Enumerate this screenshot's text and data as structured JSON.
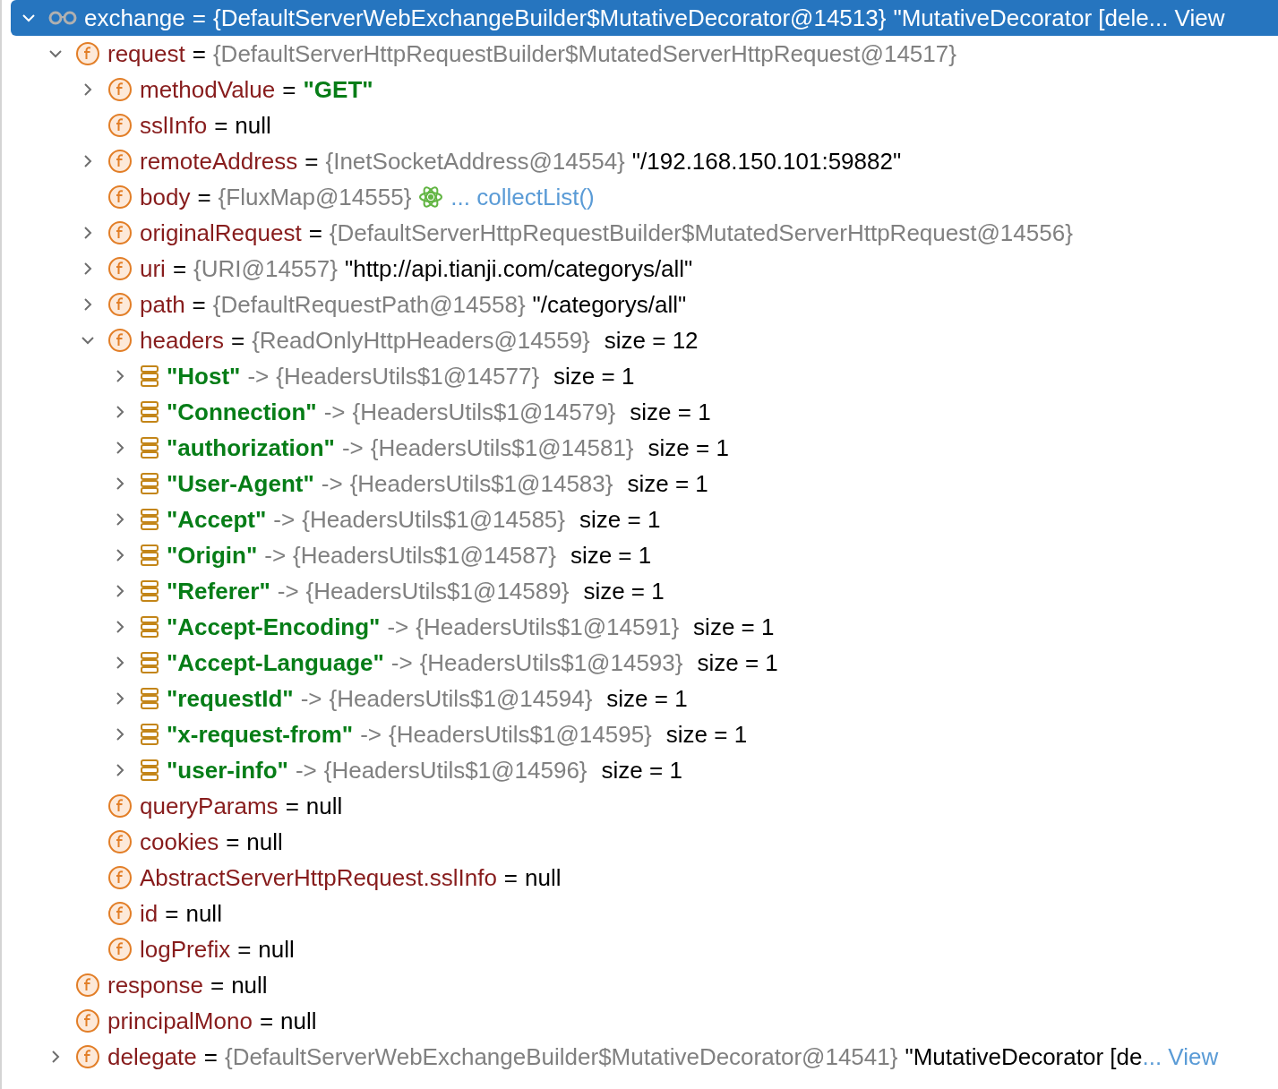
{
  "tree": [
    {
      "kind": "watch",
      "name": "exchange",
      "separator": "=",
      "type": "{DefaultServerWebExchangeBuilder$MutativeDecorator@14513}",
      "value": "\"MutativeDecorator [dele",
      "string": false,
      "link": "... View",
      "expanded": true,
      "selected": true,
      "children": [
        {
          "kind": "field",
          "name": "request",
          "separator": "=",
          "type": "{DefaultServerHttpRequestBuilder$MutatedServerHttpRequest@14517}",
          "expanded": true,
          "selected": false,
          "children": [
            {
              "kind": "field",
              "name": "methodValue",
              "separator": "=",
              "value": "\"GET\"",
              "string": true,
              "expanded": false,
              "selected": false
            },
            {
              "kind": "field",
              "name": "sslInfo",
              "separator": "=",
              "value": "null",
              "string": false,
              "selected": false
            },
            {
              "kind": "field",
              "name": "remoteAddress",
              "separator": "=",
              "type": "{InetSocketAddress@14554}",
              "value": "\"/192.168.150.101:59882\"",
              "string": false,
              "expanded": false,
              "selected": false
            },
            {
              "kind": "field",
              "name": "body",
              "separator": "=",
              "type": "{FluxMap@14555}",
              "action": true,
              "link": "... collectList()",
              "selected": false
            },
            {
              "kind": "field",
              "name": "originalRequest",
              "separator": "=",
              "type": "{DefaultServerHttpRequestBuilder$MutatedServerHttpRequest@14556}",
              "expanded": false,
              "selected": false
            },
            {
              "kind": "field",
              "name": "uri",
              "separator": "=",
              "type": "{URI@14557}",
              "value": "\"http://api.tianji.com/categorys/all\"",
              "string": false,
              "expanded": false,
              "selected": false
            },
            {
              "kind": "field",
              "name": "path",
              "separator": "=",
              "type": "{DefaultRequestPath@14558}",
              "value": "\"/categorys/all\"",
              "string": false,
              "expanded": false,
              "selected": false
            },
            {
              "kind": "field",
              "name": "headers",
              "separator": "=",
              "type": "{ReadOnlyHttpHeaders@14559}",
              "size": "size = 12",
              "expanded": true,
              "selected": false,
              "children": [
                {
                  "kind": "entry",
                  "name": "\"Host\"",
                  "separator": "->",
                  "type": "{HeadersUtils$1@14577}",
                  "size": "size = 1",
                  "expanded": false,
                  "selected": false
                },
                {
                  "kind": "entry",
                  "name": "\"Connection\"",
                  "separator": "->",
                  "type": "{HeadersUtils$1@14579}",
                  "size": "size = 1",
                  "expanded": false,
                  "selected": false
                },
                {
                  "kind": "entry",
                  "name": "\"authorization\"",
                  "separator": "->",
                  "type": "{HeadersUtils$1@14581}",
                  "size": "size = 1",
                  "expanded": false,
                  "selected": false
                },
                {
                  "kind": "entry",
                  "name": "\"User-Agent\"",
                  "separator": "->",
                  "type": "{HeadersUtils$1@14583}",
                  "size": "size = 1",
                  "expanded": false,
                  "selected": false
                },
                {
                  "kind": "entry",
                  "name": "\"Accept\"",
                  "separator": "->",
                  "type": "{HeadersUtils$1@14585}",
                  "size": "size = 1",
                  "expanded": false,
                  "selected": false
                },
                {
                  "kind": "entry",
                  "name": "\"Origin\"",
                  "separator": "->",
                  "type": "{HeadersUtils$1@14587}",
                  "size": "size = 1",
                  "expanded": false,
                  "selected": false
                },
                {
                  "kind": "entry",
                  "name": "\"Referer\"",
                  "separator": "->",
                  "type": "{HeadersUtils$1@14589}",
                  "size": "size = 1",
                  "expanded": false,
                  "selected": false
                },
                {
                  "kind": "entry",
                  "name": "\"Accept-Encoding\"",
                  "separator": "->",
                  "type": "{HeadersUtils$1@14591}",
                  "size": "size = 1",
                  "expanded": false,
                  "selected": false
                },
                {
                  "kind": "entry",
                  "name": "\"Accept-Language\"",
                  "separator": "->",
                  "type": "{HeadersUtils$1@14593}",
                  "size": "size = 1",
                  "expanded": false,
                  "selected": false
                },
                {
                  "kind": "entry",
                  "name": "\"requestId\"",
                  "separator": "->",
                  "type": "{HeadersUtils$1@14594}",
                  "size": "size = 1",
                  "expanded": false,
                  "selected": false
                },
                {
                  "kind": "entry",
                  "name": "\"x-request-from\"",
                  "separator": "->",
                  "type": "{HeadersUtils$1@14595}",
                  "size": "size = 1",
                  "expanded": false,
                  "selected": false
                },
                {
                  "kind": "entry",
                  "name": "\"user-info\"",
                  "separator": "->",
                  "type": "{HeadersUtils$1@14596}",
                  "size": "size = 1",
                  "expanded": false,
                  "selected": false
                }
              ]
            },
            {
              "kind": "field",
              "name": "queryParams",
              "separator": "=",
              "value": "null",
              "string": false,
              "selected": false
            },
            {
              "kind": "field",
              "name": "cookies",
              "separator": "=",
              "value": "null",
              "string": false,
              "selected": false
            },
            {
              "kind": "field",
              "name": "AbstractServerHttpRequest.sslInfo",
              "separator": "=",
              "value": "null",
              "string": false,
              "selected": false
            },
            {
              "kind": "field",
              "name": "id",
              "separator": "=",
              "value": "null",
              "string": false,
              "selected": false
            },
            {
              "kind": "field",
              "name": "logPrefix",
              "separator": "=",
              "value": "null",
              "string": false,
              "selected": false
            }
          ]
        },
        {
          "kind": "field",
          "name": "response",
          "separator": "=",
          "value": "null",
          "string": false,
          "selected": false
        },
        {
          "kind": "field",
          "name": "principalMono",
          "separator": "=",
          "value": "null",
          "string": false,
          "selected": false
        },
        {
          "kind": "field",
          "name": "delegate",
          "separator": "=",
          "type": "{DefaultServerWebExchangeBuilder$MutativeDecorator@14541}",
          "value": "\"MutativeDecorator [de",
          "string": false,
          "link": "... View",
          "expanded": false,
          "selected": false
        }
      ]
    }
  ]
}
